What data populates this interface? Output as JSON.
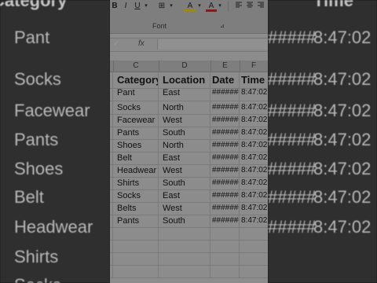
{
  "ribbon": {
    "bold": "B",
    "italic": "I",
    "underline": "U",
    "borders_label": "⊞",
    "fill_label": "A",
    "font_color_label": "A",
    "group_label": "Font",
    "launcher": "⊿"
  },
  "formula_bar": {
    "fx_label": "fx",
    "value": ""
  },
  "columns": [
    "C",
    "D",
    "E",
    "F"
  ],
  "sheet": {
    "headers": {
      "category": "Category",
      "location": "Location",
      "date": "Date",
      "time": "Time"
    },
    "rows": [
      {
        "category": "Pant",
        "location": "East",
        "date": "#######",
        "time": "8:47:02"
      },
      {
        "category": "Socks",
        "location": "North",
        "date": "#######",
        "time": "8:47:02"
      },
      {
        "category": "Facewear",
        "location": "West",
        "date": "#######",
        "time": "8:47:02"
      },
      {
        "category": "Pants",
        "location": "South",
        "date": "#######",
        "time": "8:47:02"
      },
      {
        "category": "Shoes",
        "location": "North",
        "date": "#######",
        "time": "8:47:02"
      },
      {
        "category": "Belt",
        "location": "East",
        "date": "#######",
        "time": "8:47:02"
      },
      {
        "category": "Headwear",
        "location": "West",
        "date": "#######",
        "time": "8:47:02"
      },
      {
        "category": "Shirts",
        "location": "South",
        "date": "#######",
        "time": "8:47:02"
      },
      {
        "category": "Socks",
        "location": "East",
        "date": "#######",
        "time": "8:47:02"
      },
      {
        "category": "Belts",
        "location": "West",
        "date": "#######",
        "time": "8:47:02"
      },
      {
        "category": "Pants",
        "location": "South",
        "date": "#######",
        "time": "8:47:02"
      }
    ]
  },
  "background_left": {
    "header": "Category",
    "items": [
      "Pant",
      "Socks",
      "Facewear",
      "Pants",
      "Shoes",
      "Belt",
      "Headwear",
      "Shirts",
      "Socks"
    ]
  },
  "background_right": {
    "header": "Time",
    "date_fill": "#####",
    "time": "8:47:02"
  },
  "colors": {
    "background_dim": "#2f2f2f",
    "sheet_gray": "#8c8c8c"
  }
}
